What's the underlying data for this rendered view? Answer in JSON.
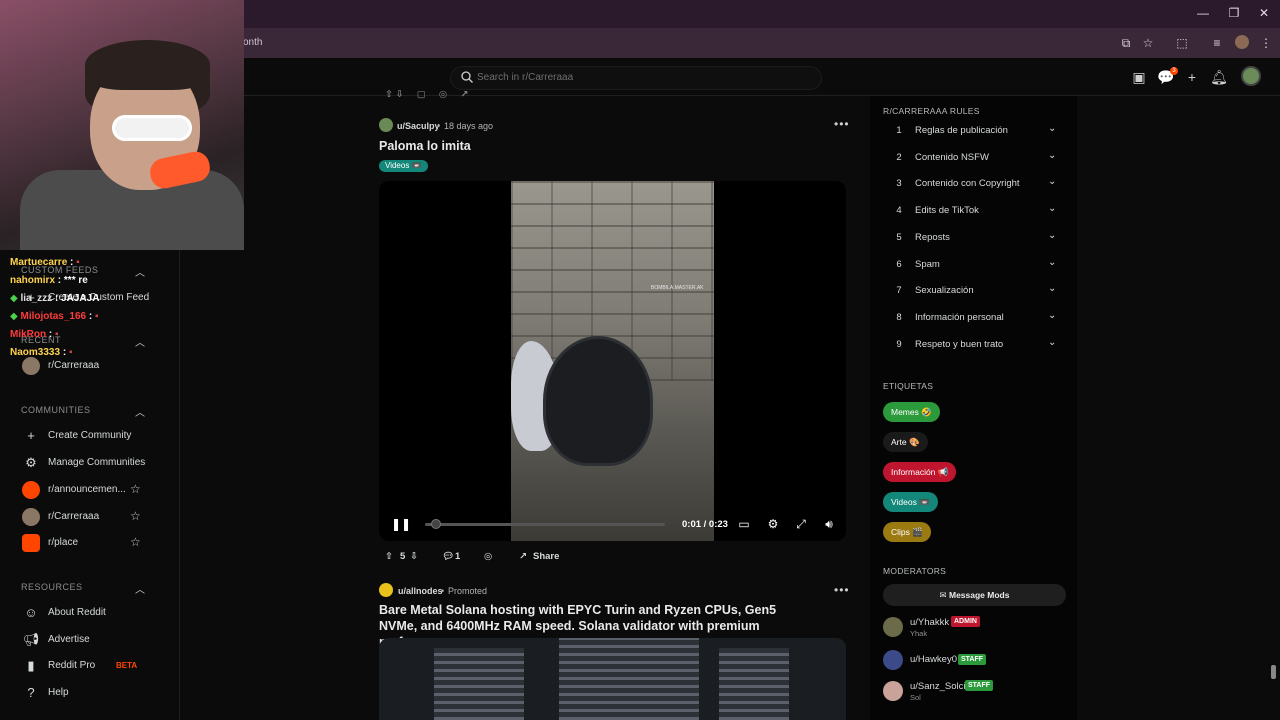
{
  "browser": {
    "url_fragment": "onth"
  },
  "header": {
    "search_placeholder": "Search in r/Carreraaa",
    "notif_count": "3"
  },
  "chat": [
    {
      "user": "Martuecarre",
      "msg": ":",
      "color": "#ffd34d"
    },
    {
      "user": "nahomirx",
      "msg": ": *** re",
      "color": "#ffd34d"
    },
    {
      "user": "lia_zzz",
      "msg": ": JAJAJA",
      "color": "#e0e0e0"
    },
    {
      "user": "Milojotas_166",
      "msg": ":",
      "color": "#ff3b3b"
    },
    {
      "user": "MikRon",
      "msg": ":",
      "color": "#ff3b3b"
    },
    {
      "user": "Naom3333",
      "msg": ":",
      "color": "#ffd34d"
    }
  ],
  "sidebar": {
    "custom_feeds_title": "CUSTOM FEEDS",
    "create_feed_label": "Create a Custom Feed",
    "recent_title": "RECENT",
    "recent_items": [
      {
        "label": "r/Carreraaa"
      }
    ],
    "communities_title": "COMMUNITIES",
    "communities": [
      {
        "label": "Create Community"
      },
      {
        "label": "Manage Communities"
      },
      {
        "label": "r/announcemen..."
      },
      {
        "label": "r/Carreraaa"
      },
      {
        "label": "r/place"
      }
    ],
    "resources_title": "RESOURCES",
    "resources": [
      {
        "label": "About Reddit"
      },
      {
        "label": "Advertise"
      },
      {
        "label": "Reddit Pro",
        "badge": "BETA"
      },
      {
        "label": "Help"
      }
    ]
  },
  "feed": {
    "post1": {
      "author": "u/Saculpy",
      "age": "18 days ago",
      "title": "Paloma lo imita",
      "flair": "Videos 📼",
      "video_time": "0:01 / 0:23",
      "watermark": "BOMBILA.MASTER.AK",
      "score": "5",
      "comments": "1",
      "share": "Share"
    },
    "post2": {
      "author": "u/allnodes",
      "promoted": "Promoted",
      "title": "Bare Metal Solana hosting with EPYC Turin and Ryzen CPUs, Gen5 NVMe, and 6400MHz RAM speed. Solana validator with premium performance specs."
    }
  },
  "right_sidebar": {
    "rules_title": "R/CARRERAAA RULES",
    "rules": [
      {
        "n": "1",
        "text": "Reglas de publicación"
      },
      {
        "n": "2",
        "text": "Contenido NSFW"
      },
      {
        "n": "3",
        "text": "Contenido con Copyright"
      },
      {
        "n": "4",
        "text": "Edits de TikTok"
      },
      {
        "n": "5",
        "text": "Reposts"
      },
      {
        "n": "6",
        "text": "Spam"
      },
      {
        "n": "7",
        "text": "Sexualización"
      },
      {
        "n": "8",
        "text": "Información personal"
      },
      {
        "n": "9",
        "text": "Respeto y buen trato"
      }
    ],
    "tags_title": "ETIQUETAS",
    "tags": [
      {
        "label": "Memes 🤣",
        "color": "#2b9a3a"
      },
      {
        "label": "Arte 🎨",
        "color": "#1a1a1a"
      },
      {
        "label": "Información 📢",
        "color": "#c0152f"
      },
      {
        "label": "Videos 📼",
        "color": "#13877a"
      },
      {
        "label": "Clips 🎬",
        "color": "#9c7a12"
      }
    ],
    "mods_title": "MODERATORS",
    "message_mods": "Message Mods",
    "mods": [
      {
        "user": "u/Yhakkk",
        "sub": "Yhak",
        "badge": "ADMIN",
        "badge_color": "#c0152f"
      },
      {
        "user": "u/Hawkey0",
        "sub": "",
        "badge": "STAFF",
        "badge_color": "#2b9a3a"
      },
      {
        "user": "u/Sanz_Solci",
        "sub": "Sol",
        "badge": "STAFF",
        "badge_color": "#2b9a3a"
      }
    ]
  }
}
